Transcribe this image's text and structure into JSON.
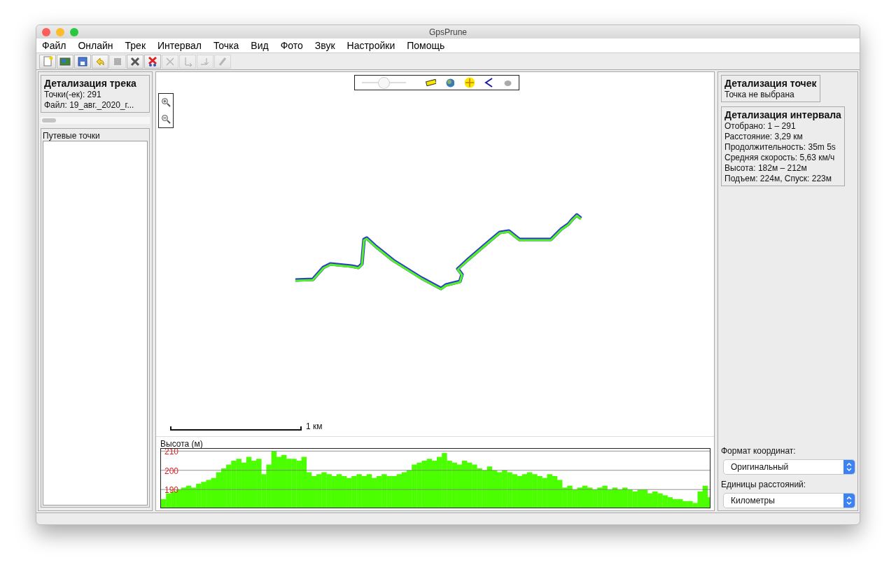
{
  "window": {
    "title": "GpsPrune"
  },
  "menu": [
    "Файл",
    "Онлайн",
    "Трек",
    "Интервал",
    "Точка",
    "Вид",
    "Фото",
    "Звук",
    "Настройки",
    "Помощь"
  ],
  "toolbar": [
    {
      "kind": "new",
      "disabled": false
    },
    {
      "kind": "image",
      "disabled": false
    },
    {
      "kind": "save",
      "disabled": false
    },
    {
      "kind": "undo",
      "disabled": false
    },
    {
      "kind": "stop",
      "disabled": true
    },
    {
      "kind": "delete",
      "disabled": false
    },
    {
      "kind": "delete-range",
      "disabled": false
    },
    {
      "kind": "cut",
      "disabled": true
    },
    {
      "kind": "start",
      "disabled": true
    },
    {
      "kind": "end",
      "disabled": true
    },
    {
      "kind": "connect",
      "disabled": true
    }
  ],
  "track_details": {
    "title": "Детализация трека",
    "lines": [
      "Точки(-ек): 291",
      "Файл: 19_авг._2020_г..."
    ]
  },
  "waypoints": {
    "title": "Путевые точки"
  },
  "map": {
    "zoom_slider": {
      "level": 0.5
    },
    "scale_label": "1 км"
  },
  "profile": {
    "title": "Высота (м)",
    "chart_data": {
      "type": "bar",
      "grid": true,
      "ylim": [
        180.6,
        211.2
      ],
      "yticks": [
        190,
        200,
        210
      ],
      "values": [
        185,
        188,
        189,
        190,
        191,
        192,
        191,
        193,
        194,
        195,
        196,
        199,
        201,
        203,
        205,
        206,
        204,
        207,
        205,
        206,
        198,
        203,
        210,
        207,
        208,
        206,
        206,
        205,
        207,
        199,
        197,
        198,
        199,
        198,
        197,
        198,
        197,
        196,
        197,
        198,
        197,
        198,
        196,
        197,
        198,
        197,
        197,
        198,
        199,
        200,
        203,
        204,
        205,
        206,
        205,
        207,
        209,
        205,
        204,
        203,
        205,
        204,
        203,
        201,
        200,
        202,
        200,
        199,
        200,
        199,
        198,
        197,
        198,
        199,
        198,
        197,
        196,
        198,
        197,
        195,
        191,
        192,
        190,
        191,
        192,
        191,
        190,
        191,
        192,
        190,
        191,
        190,
        191,
        190,
        189,
        190,
        190,
        188,
        189,
        188,
        187,
        186,
        185,
        185,
        184,
        184,
        183,
        189,
        192,
        186
      ]
    }
  },
  "point_details": {
    "title": "Детализация точек",
    "lines": [
      "Точка не выбрана"
    ]
  },
  "range_details": {
    "title": "Детализация интервала",
    "lines": [
      "Отобрано: 1 – 291",
      "Расстояние: 3,29 км",
      "Продолжительность: 35m 5s",
      "Средняя скорость: 5,63 км/ч",
      "Высота: 182м – 212м",
      "Подъем: 224м, Спуск: 223м"
    ]
  },
  "settings": [
    {
      "label": "Формат координат:",
      "value": "Оригинальный"
    },
    {
      "label": "Единицы расстояний:",
      "value": "Километры"
    }
  ]
}
